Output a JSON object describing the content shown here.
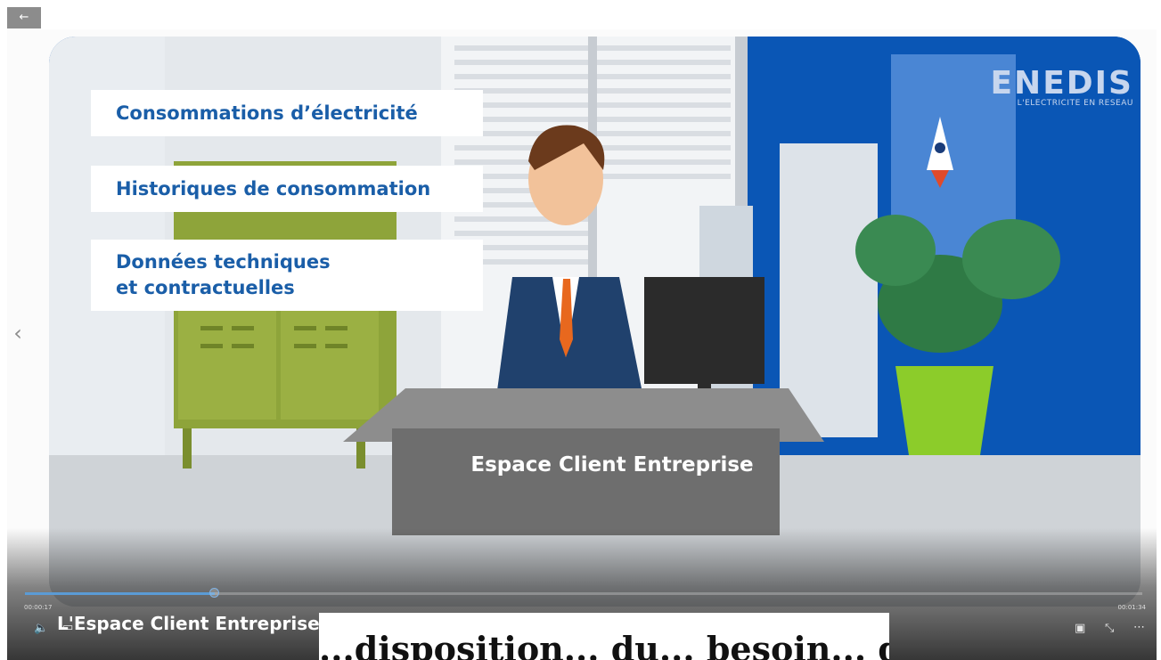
{
  "nav": {
    "back_glyph": "←",
    "prev_glyph": "‹"
  },
  "slide": {
    "captions": [
      "Consommations d’électricité",
      "Historiques de consommation",
      "Données techniques",
      "et contractuelles"
    ],
    "logo_word": "ENEDIS",
    "logo_tagline": "L'ELECTRICITE EN RESEAU",
    "desk_sign": "Espace Client Entreprise"
  },
  "player": {
    "current_time": "00:00:17",
    "total_time": "00:01:34",
    "progress": 0.17,
    "title": "L'Espace Client Entreprise : l'Excellent fait ce que vous",
    "icons": [
      "volume-icon",
      "captions-icon",
      "picture-in-picture-icon",
      "exit-fullscreen-icon",
      "more-options-icon"
    ],
    "volume_glyph": "🔈",
    "captions_glyph": "▭",
    "pip_glyph": "▣",
    "exit_fullscreen_glyph": "⤡",
    "more_glyph": "⋯"
  },
  "subtitle": {
    "text": "...disposition... du... besoin... de... l'électri..."
  },
  "colors": {
    "brand_blue": "#1a5ea8",
    "wall_blue": "#0a56b5",
    "locker_green": "#8ea43a",
    "progress": "#5b9bd5"
  }
}
